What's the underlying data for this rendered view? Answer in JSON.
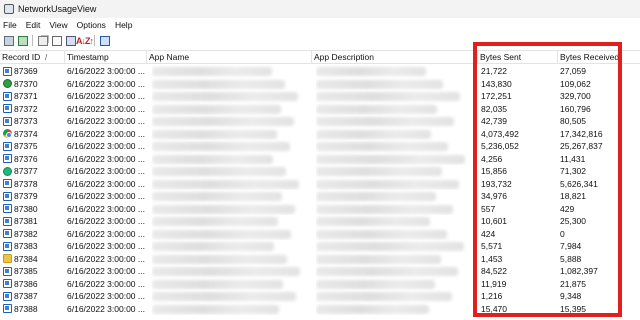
{
  "window": {
    "title": "NetworkUsageView"
  },
  "menu": [
    "File",
    "Edit",
    "View",
    "Options",
    "Help"
  ],
  "toolbar": {
    "icons": [
      "save-icon",
      "export-icon",
      "copy-icon",
      "properties-icon",
      "find-icon",
      "sort-icon",
      "exit-icon"
    ],
    "sort_glyph": "A↓Z↑"
  },
  "columns": {
    "record_id": "Record ID",
    "sort_indicator": "/",
    "timestamp": "Timestamp",
    "app_name": "App Name",
    "app_description": "App Description",
    "bytes_sent": "Bytes Sent",
    "bytes_received": "Bytes Received"
  },
  "rows": [
    {
      "id": "87369",
      "icon": "app-icon",
      "timestamp": "6/16/2022 3:00:00 ...",
      "sent": "21,722",
      "received": "27,059"
    },
    {
      "id": "87370",
      "icon": "green-circle-icon",
      "timestamp": "6/16/2022 3:00:00 ...",
      "sent": "143,830",
      "received": "109,062"
    },
    {
      "id": "87371",
      "icon": "app-icon",
      "timestamp": "6/16/2022 3:00:00 ...",
      "sent": "172,251",
      "received": "329,700"
    },
    {
      "id": "87372",
      "icon": "app-icon",
      "timestamp": "6/16/2022 3:00:00 ...",
      "sent": "82,035",
      "received": "160,796"
    },
    {
      "id": "87373",
      "icon": "app-icon",
      "timestamp": "6/16/2022 3:00:00 ...",
      "sent": "42,739",
      "received": "80,505"
    },
    {
      "id": "87374",
      "icon": "chrome-icon",
      "timestamp": "6/16/2022 3:00:00 ...",
      "sent": "4,073,492",
      "received": "17,342,816"
    },
    {
      "id": "87375",
      "icon": "app-icon",
      "timestamp": "6/16/2022 3:00:00 ...",
      "sent": "5,236,052",
      "received": "25,267,837"
    },
    {
      "id": "87376",
      "icon": "app-icon",
      "timestamp": "6/16/2022 3:00:00 ...",
      "sent": "4,256",
      "received": "11,431"
    },
    {
      "id": "87377",
      "icon": "teal-circle-icon",
      "timestamp": "6/16/2022 3:00:00 ...",
      "sent": "15,856",
      "received": "71,302"
    },
    {
      "id": "87378",
      "icon": "app-icon",
      "timestamp": "6/16/2022 3:00:00 ...",
      "sent": "193,732",
      "received": "5,626,341"
    },
    {
      "id": "87379",
      "icon": "app-icon",
      "timestamp": "6/16/2022 3:00:00 ...",
      "sent": "34,976",
      "received": "18,821"
    },
    {
      "id": "87380",
      "icon": "app-icon",
      "timestamp": "6/16/2022 3:00:00 ...",
      "sent": "557",
      "received": "429"
    },
    {
      "id": "87381",
      "icon": "app-icon",
      "timestamp": "6/16/2022 3:00:00 ...",
      "sent": "10,601",
      "received": "25,300"
    },
    {
      "id": "87382",
      "icon": "app-icon",
      "timestamp": "6/16/2022 3:00:00 ...",
      "sent": "424",
      "received": "0"
    },
    {
      "id": "87383",
      "icon": "app-icon",
      "timestamp": "6/16/2022 3:00:00 ...",
      "sent": "5,571",
      "received": "7,984"
    },
    {
      "id": "87384",
      "icon": "folder-icon",
      "timestamp": "6/16/2022 3:00:00 ...",
      "sent": "1,453",
      "received": "5,888"
    },
    {
      "id": "87385",
      "icon": "app-icon",
      "timestamp": "6/16/2022 3:00:00 ...",
      "sent": "84,522",
      "received": "1,082,397"
    },
    {
      "id": "87386",
      "icon": "app-icon",
      "timestamp": "6/16/2022 3:00:00 ...",
      "sent": "11,919",
      "received": "21,875"
    },
    {
      "id": "87387",
      "icon": "app-icon",
      "timestamp": "6/16/2022 3:00:00 ...",
      "sent": "1,216",
      "received": "9,348"
    },
    {
      "id": "87388",
      "icon": "app-icon",
      "timestamp": "6/16/2022 3:00:00 ...",
      "sent": "15,470",
      "received": "15,395"
    }
  ],
  "colors": {
    "highlight": "#e01f1f",
    "header_border": "#e3e3e3"
  }
}
